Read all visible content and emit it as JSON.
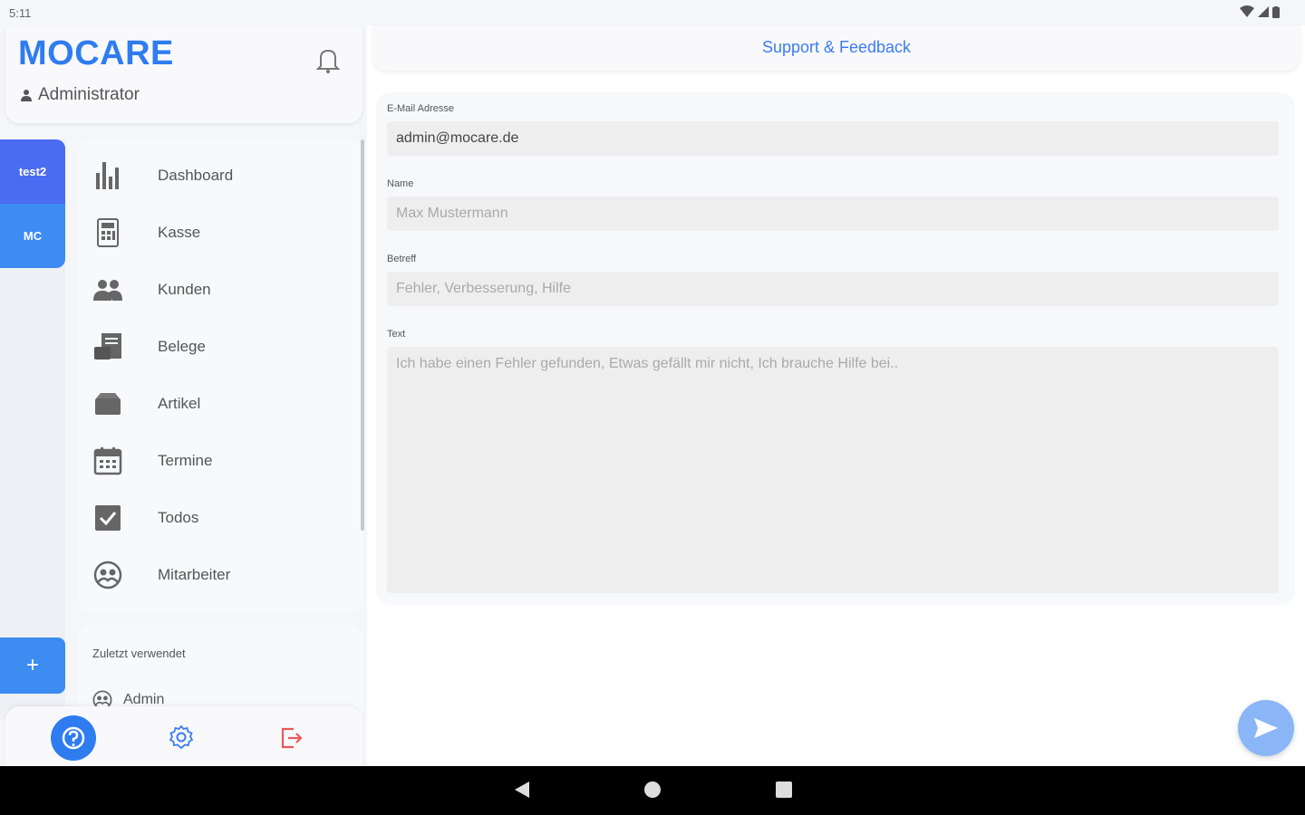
{
  "status": {
    "time": "5:11"
  },
  "brand": {
    "name": "MOCARE",
    "role": "Administrator"
  },
  "tenants": [
    "test2",
    "MC"
  ],
  "menu": [
    {
      "label": "Dashboard",
      "icon": "bar-chart-icon"
    },
    {
      "label": "Kasse",
      "icon": "calculator-icon"
    },
    {
      "label": "Kunden",
      "icon": "people-icon"
    },
    {
      "label": "Belege",
      "icon": "receipt-icon"
    },
    {
      "label": "Artikel",
      "icon": "box-icon"
    },
    {
      "label": "Termine",
      "icon": "calendar-icon"
    },
    {
      "label": "Todos",
      "icon": "checkbox-icon"
    },
    {
      "label": "Mitarbeiter",
      "icon": "employees-icon"
    }
  ],
  "add_label": "+",
  "recent": {
    "title": "Zuletzt verwendet",
    "items": [
      "Admin"
    ]
  },
  "page": {
    "title": "Support & Feedback"
  },
  "form": {
    "email": {
      "label": "E-Mail Adresse",
      "value": "admin@mocare.de"
    },
    "name": {
      "label": "Name",
      "placeholder": "Max Mustermann"
    },
    "subject": {
      "label": "Betreff",
      "placeholder": "Fehler, Verbesserung, Hilfe"
    },
    "text": {
      "label": "Text",
      "placeholder": "Ich habe einen Fehler gefunden, Etwas gefällt mir nicht, Ich brauche Hilfe bei.."
    }
  },
  "colors": {
    "accent": "#2f7cf0",
    "tenant_active": "#4a6cf0",
    "logout": "#e85a5a"
  }
}
